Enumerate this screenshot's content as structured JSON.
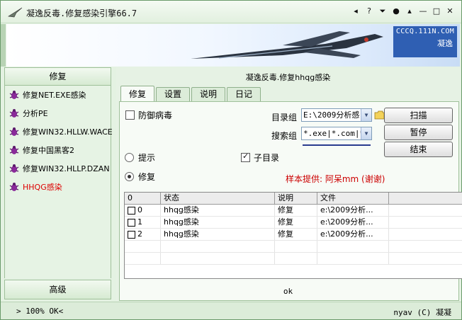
{
  "window": {
    "title": "凝逸反毒.修复感染引擎66.7",
    "controls": [
      "◂",
      "?",
      "⏷",
      "●",
      "▴",
      "—",
      "□",
      "✕"
    ]
  },
  "banner": {
    "site": "CCCQ.111N.COM",
    "brand": "凝逸"
  },
  "sidebar": {
    "header": "修复",
    "items": [
      {
        "label": "修复NET.EXE感染"
      },
      {
        "label": "分析PE"
      },
      {
        "label": "修复WIN32.HLLW.WACE"
      },
      {
        "label": "修复中国黑客2"
      },
      {
        "label": "修复WIN32.HLLP.DZAN"
      },
      {
        "label": "HHQG感染",
        "active": true
      }
    ],
    "footer": "高级"
  },
  "main": {
    "heading": "凝逸反毒.修复hhqg感染",
    "tabs": [
      {
        "label": "修复",
        "active": true
      },
      {
        "label": "设置"
      },
      {
        "label": "说明"
      },
      {
        "label": "日记"
      }
    ],
    "defense_label": "防御病毒",
    "dir_label": "目录组",
    "dir_value": "E:\\2009分析感",
    "search_label": "搜索组",
    "search_value": "*.exe|*.com|*",
    "scan_button": "扫描",
    "pause_button": "暂停",
    "end_button": "结束",
    "radio_prompt": "提示",
    "radio_repair": "修复",
    "subdir_label": "子目录",
    "sample_note": "样本提供: 阿呆mm  (谢谢)",
    "table": {
      "headers": [
        "0",
        "状态",
        "说明",
        "文件",
        ""
      ],
      "rows": [
        {
          "id": "0",
          "status": "hhqg感染",
          "desc": "修复",
          "file": "e:\\2009分析..."
        },
        {
          "id": "1",
          "status": "hhqg感染",
          "desc": "修复",
          "file": "e:\\2009分析..."
        },
        {
          "id": "2",
          "status": "hhqg感染",
          "desc": "修复",
          "file": "e:\\2009分析..."
        }
      ]
    },
    "status_text": "ok"
  },
  "statusbar": {
    "left": "> 100% OK<",
    "right": "nyav (C) 凝凝"
  },
  "colors": {
    "accent_green": "#e4f2e2",
    "banner_blue": "#2f5fb3",
    "note_red": "#cc0000",
    "active_item_red": "#dd0000"
  }
}
